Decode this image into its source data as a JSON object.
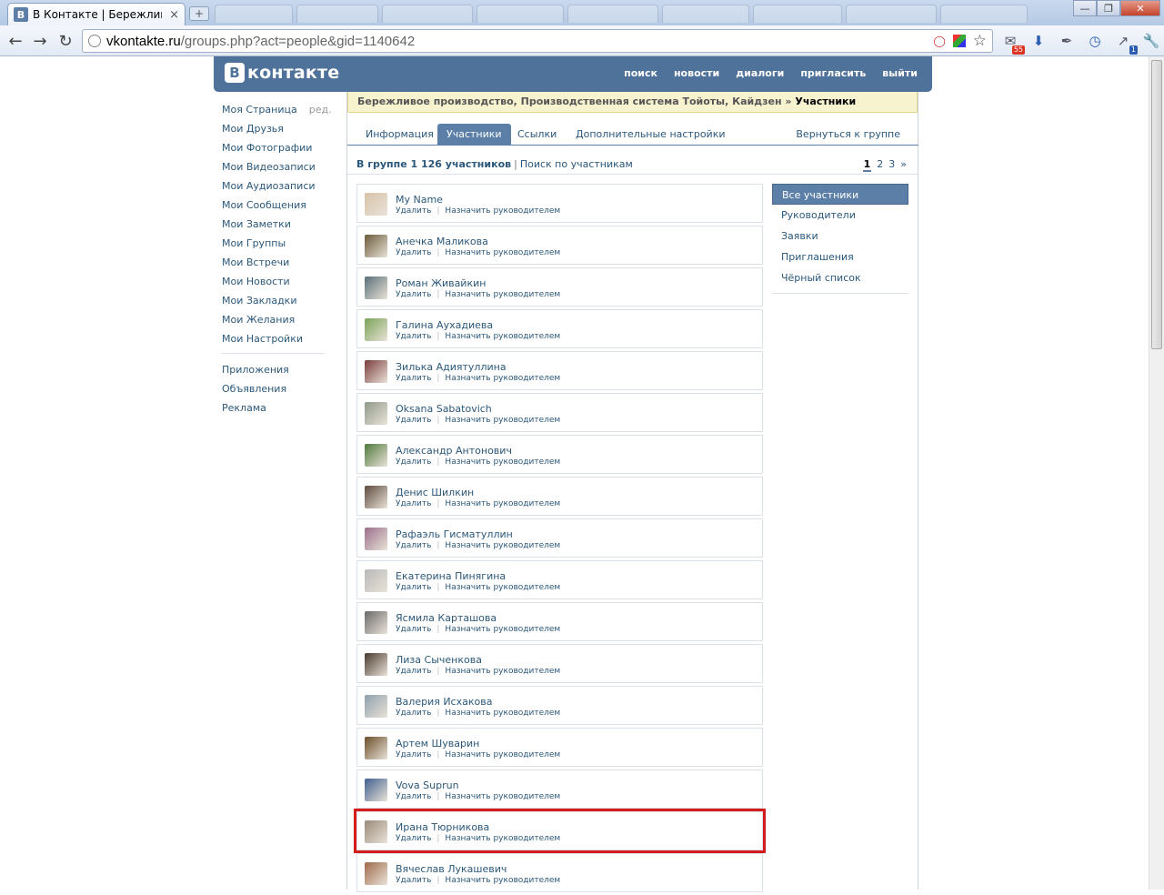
{
  "browser": {
    "tab_title": "В Контакте | Бережливо...",
    "tab_favicon": "B",
    "tab_close": "×",
    "new_tab": "+",
    "url_host": "vkontakte.ru",
    "url_path": "/groups.php?act=people&gid=1140642",
    "ext_badge_mail": "55",
    "ext_badge_dl": "1",
    "icons": [
      "back-icon",
      "forward-icon",
      "reload-icon",
      "star-icon",
      "mail-icon",
      "download-icon",
      "eyedropper-icon",
      "clock-icon",
      "resize-icon",
      "wrench-icon"
    ]
  },
  "vk": {
    "logo_b": "B",
    "logo_word": "контакте",
    "nav": [
      "поиск",
      "новости",
      "диалоги",
      "пригласить",
      "выйти"
    ]
  },
  "left_menu": {
    "items": [
      "Моя Страница",
      "Мои Друзья",
      "Мои Фотографии",
      "Мои Видеозаписи",
      "Мои Аудиозаписи",
      "Мои Сообщения",
      "Мои Заметки",
      "Мои Группы",
      "Мои Встречи",
      "Мои Новости",
      "Мои Закладки",
      "Мои Желания",
      "Мои Настройки"
    ],
    "edit": "ред.",
    "extra": [
      "Приложения",
      "Объявления",
      "Реклама"
    ]
  },
  "group": {
    "crumb_group": "Бережливое производство, Производственная система Тойоты, Кайдзен",
    "crumb_sep": "»",
    "crumb_current": "Участники",
    "tabs": [
      "Информация",
      "Участники",
      "Ссылки",
      "Дополнительные настройки"
    ],
    "back": "Вернуться к группе",
    "count_text": "В группе 1 126 участников",
    "bar": "|",
    "search_link": "Поиск по участникам",
    "pages": [
      "1",
      "2",
      "3",
      "»"
    ]
  },
  "actions": {
    "remove": "Удалить",
    "sep": "|",
    "assign": "Назначить руководителем"
  },
  "members": [
    {
      "name": "My Name",
      "color": "#d8c3a8"
    },
    {
      "name": "Анечка Маликова",
      "color": "#6b5a3a"
    },
    {
      "name": "Роман Живайкин",
      "color": "#5a6f78"
    },
    {
      "name": "Галина Аухадиева",
      "color": "#7aa356"
    },
    {
      "name": "Зилька Адиятуллина",
      "color": "#7a3b3b"
    },
    {
      "name": "Oksana Sabatovich",
      "color": "#8f9a8a"
    },
    {
      "name": "Александр Антонович",
      "color": "#4f7a3c"
    },
    {
      "name": "Денис Шилкин",
      "color": "#5d4a3c"
    },
    {
      "name": "Рафаэль Гисматуллин",
      "color": "#9a6f8a"
    },
    {
      "name": "Екатерина Пинягина",
      "color": "#b9b9b9"
    },
    {
      "name": "Ясмила Карташова",
      "color": "#6a6a6a"
    },
    {
      "name": "Лиза Сыченкова",
      "color": "#4a3a2e"
    },
    {
      "name": "Валерия Исхакова",
      "color": "#8fa1ad"
    },
    {
      "name": "Артем Шуварин",
      "color": "#6b4e2a"
    },
    {
      "name": "Vova Suprun",
      "color": "#3f5f8f"
    },
    {
      "name": "Ирана Тюрникова",
      "color": "#9a8a7a",
      "highlighted": true
    },
    {
      "name": "Вячеслав Лукашевич",
      "color": "#a06a4a"
    }
  ],
  "filters": {
    "items": [
      "Все участники",
      "Руководители",
      "Заявки",
      "Приглашения",
      "Чёрный список"
    ],
    "selected": 0
  },
  "colors": {
    "vk_blue": "#4e729a",
    "link": "#2b587a",
    "highlight": "#d51c1c"
  }
}
